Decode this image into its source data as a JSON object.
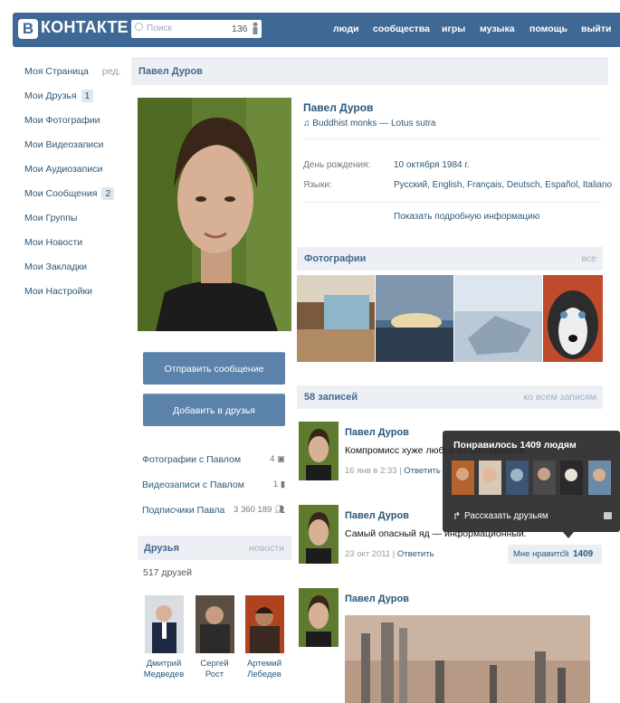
{
  "header": {
    "logo_letter": "В",
    "logo_text": "КОНТАКТЕ",
    "search_placeholder": "Поиск",
    "search_count": "136",
    "nav": [
      "люди",
      "сообщества",
      "игры",
      "музыка",
      "помощь",
      "выйти"
    ]
  },
  "left_menu": {
    "items": [
      {
        "label": "Моя Страница",
        "extra": "ред."
      },
      {
        "label": "Мои Друзья",
        "badge": "1"
      },
      {
        "label": "Мои Фотографии"
      },
      {
        "label": "Мои Видеозаписи"
      },
      {
        "label": "Мои Аудиозаписи"
      },
      {
        "label": "Мои Сообщения",
        "badge": "2"
      },
      {
        "label": "Мои Группы"
      },
      {
        "label": "Мои Новости"
      },
      {
        "label": "Мои Закладки"
      },
      {
        "label": "Мои Настройки"
      }
    ]
  },
  "profile": {
    "page_title": "Павел Дуров",
    "name": "Павел Дуров",
    "status": "♫ Buddhist monks — Lotus sutra",
    "birthday_label": "День рождения:",
    "birthday_value": "10 октября 1984 г.",
    "languages_label": "Языки:",
    "languages_value": "Русский, English, Français, Deutsch, Español, Italiano",
    "show_more": "Показать подробную информацию"
  },
  "actions": {
    "send_message": "Отправить сообщение",
    "add_friend": "Добавить в друзья"
  },
  "stats": [
    {
      "label": "Фотографии с Павлом",
      "count": "4"
    },
    {
      "label": "Видеозаписи с Павлом",
      "count": "1"
    },
    {
      "label": "Подписчики Павла",
      "count": "3 360 189"
    }
  ],
  "friends": {
    "title": "Друзья",
    "link": "новости",
    "count": "517 друзей",
    "list": [
      {
        "first": "Дмитрий",
        "last": "Медведев"
      },
      {
        "first": "Сергей",
        "last": "Рост"
      },
      {
        "first": "Артемий",
        "last": "Лебедев"
      }
    ]
  },
  "photos": {
    "title": "Фотографии",
    "link": "все"
  },
  "wall": {
    "title": "58 записей",
    "link": "ко всем записям",
    "posts": [
      {
        "author": "Павел Дуров",
        "text": "Компромисс хуже любой из альтернатив.",
        "date": "16 янв в 2:33",
        "reply": "Ответить"
      },
      {
        "author": "Павел Дуров",
        "text": "Самый опасный яд — информационный.",
        "date": "23 окт 2011",
        "reply": "Ответить"
      },
      {
        "author": "Павел Дуров",
        "text": "",
        "date": "",
        "reply": ""
      }
    ],
    "like_label": "Мне нравится",
    "like_count": "1409"
  },
  "popup": {
    "title": "Понравилось 1409 людям",
    "share": "Рассказать друзьям"
  },
  "colors": {
    "header": "#3f6894",
    "link": "#2b587a",
    "button": "#5b82ab",
    "section": "#ecf0f4"
  }
}
